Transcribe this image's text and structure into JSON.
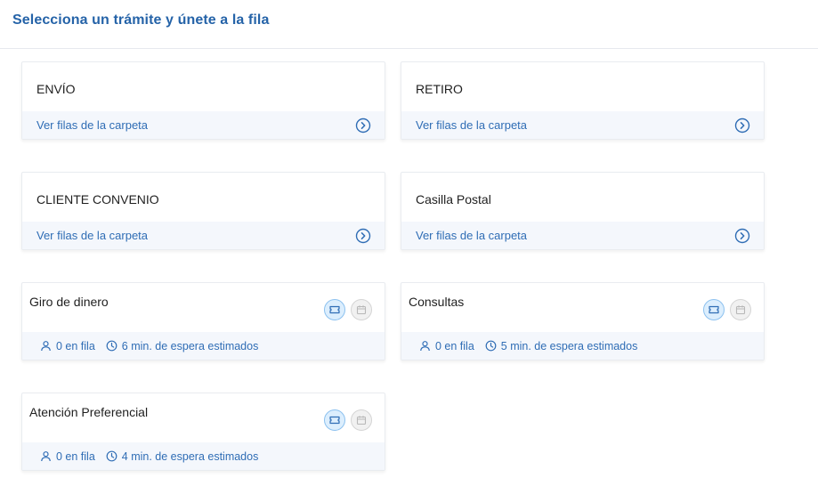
{
  "header": {
    "title": "Selecciona un trámite y únete a la fila"
  },
  "folders": [
    {
      "name": "ENVÍO",
      "link": "Ver filas de la carpeta"
    },
    {
      "name": "RETIRO",
      "link": "Ver filas de la carpeta"
    },
    {
      "name": "CLIENTE CONVENIO",
      "link": "Ver filas de la carpeta"
    },
    {
      "name": "Casilla Postal",
      "link": "Ver filas de la carpeta"
    }
  ],
  "queues": [
    {
      "name": "Giro de dinero",
      "people": "0 en fila",
      "wait": "6 min. de espera estimados"
    },
    {
      "name": "Consultas",
      "people": "0 en fila",
      "wait": "5 min. de espera estimados"
    },
    {
      "name": "Atención Preferencial",
      "people": "0 en fila",
      "wait": "4 min. de espera estimados"
    }
  ],
  "colors": {
    "accent": "#2563a8",
    "link": "#2f6db5",
    "footer_bg": "#f4f7fc"
  },
  "icons": {
    "folder_action": "chevron-right-circle-icon",
    "people": "user-icon",
    "wait": "clock-icon",
    "join": "ticket-icon",
    "schedule": "calendar-icon"
  }
}
